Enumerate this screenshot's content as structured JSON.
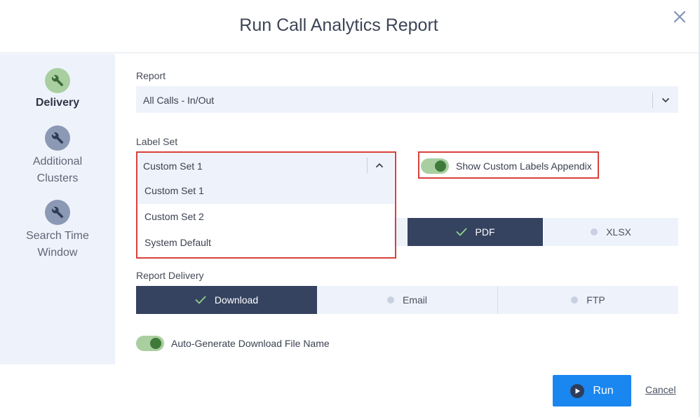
{
  "dialog": {
    "title": "Run Call Analytics Report",
    "close_icon": "close-icon"
  },
  "sidebar": {
    "steps": [
      {
        "label": "Delivery",
        "icon": "wrench-icon",
        "active": true
      },
      {
        "label": "Additional Clusters",
        "icon": "wrench-icon",
        "active": false
      },
      {
        "label": "Search Time Window",
        "icon": "wrench-icon",
        "active": false
      }
    ]
  },
  "report": {
    "label": "Report",
    "value": "All Calls - In/Out"
  },
  "label_set": {
    "label": "Label Set",
    "value": "Custom Set 1",
    "expanded": true,
    "options": [
      "Custom Set 1",
      "Custom Set 2",
      "System Default"
    ]
  },
  "appendix_toggle": {
    "label": "Show Custom Labels Appendix",
    "on": true
  },
  "format": {
    "options": [
      {
        "label": "PDF",
        "selected": true
      },
      {
        "label": "XLSX",
        "selected": false
      }
    ]
  },
  "delivery": {
    "label": "Report Delivery",
    "options": [
      {
        "label": "Download",
        "selected": true
      },
      {
        "label": "Email",
        "selected": false
      },
      {
        "label": "FTP",
        "selected": false
      }
    ]
  },
  "auto_name_toggle": {
    "label": "Auto-Generate Download File Name",
    "on": true
  },
  "footer": {
    "run_label": "Run",
    "cancel_label": "Cancel"
  },
  "colors": {
    "primary": "#1a86f0",
    "selected_segment": "#354360",
    "toggle_track": "#a9cfa0",
    "toggle_knob": "#3f7a3a",
    "highlight": "#d9413b",
    "panel": "#eef3fb"
  }
}
